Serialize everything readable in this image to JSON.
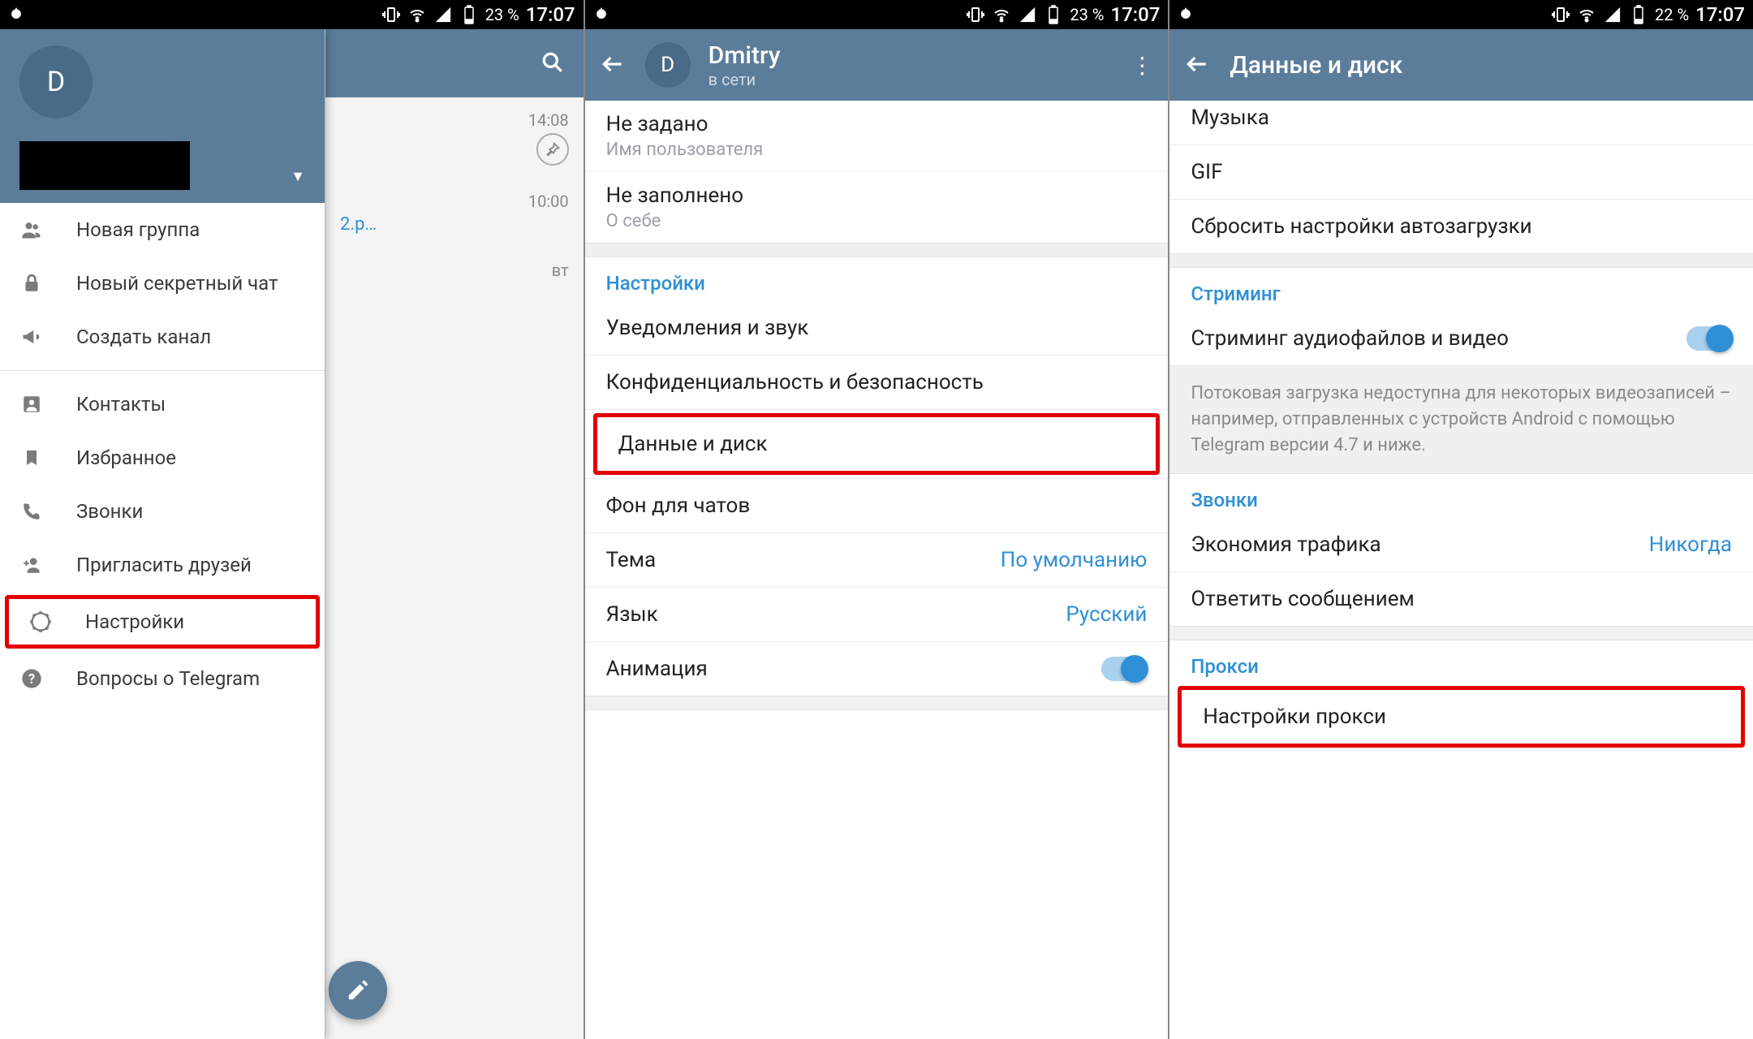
{
  "status": {
    "battery_s1": "23 %",
    "battery_s2": "23 %",
    "battery_s3": "22 %",
    "time": "17:07"
  },
  "s1": {
    "avatar_initial": "D",
    "drawer": [
      "Новая группа",
      "Новый секретный чат",
      "Создать канал",
      "Контакты",
      "Избранное",
      "Звонки",
      "Пригласить друзей",
      "Настройки",
      "Вопросы о Telegram"
    ],
    "bg_times": [
      "14:08",
      "10:00",
      "вт"
    ],
    "bg_snippet": "2.р…"
  },
  "s2": {
    "title": "Dmitry",
    "subtitle": "в сети",
    "avatar_initial": "D",
    "username_value": "Не задано",
    "username_label": "Имя пользователя",
    "about_value": "Не заполнено",
    "about_label": "О себе",
    "section": "Настройки",
    "items": [
      "Уведомления и звук",
      "Конфиденциальность и безопасность",
      "Данные и диск",
      "Фон для чатов"
    ],
    "theme_label": "Тема",
    "theme_value": "По умолчанию",
    "lang_label": "Язык",
    "lang_value": "Русский",
    "anim_label": "Анимация"
  },
  "s3": {
    "title": "Данные и диск",
    "music": "Музыка",
    "gif": "GIF",
    "reset": "Сбросить настройки автозагрузки",
    "stream_section": "Стриминг",
    "stream_item": "Стриминг аудиофайлов и видео",
    "stream_note": "Потоковая загрузка недоступна для некоторых видеозаписей – например, отправленных с устройств Android с помощью Telegram версии 4.7 и ниже.",
    "calls_section": "Звонки",
    "calls_economy": "Экономия трафика",
    "calls_economy_value": "Никогда",
    "calls_reply": "Ответить сообщением",
    "proxy_section": "Прокси",
    "proxy_item": "Настройки прокси"
  }
}
